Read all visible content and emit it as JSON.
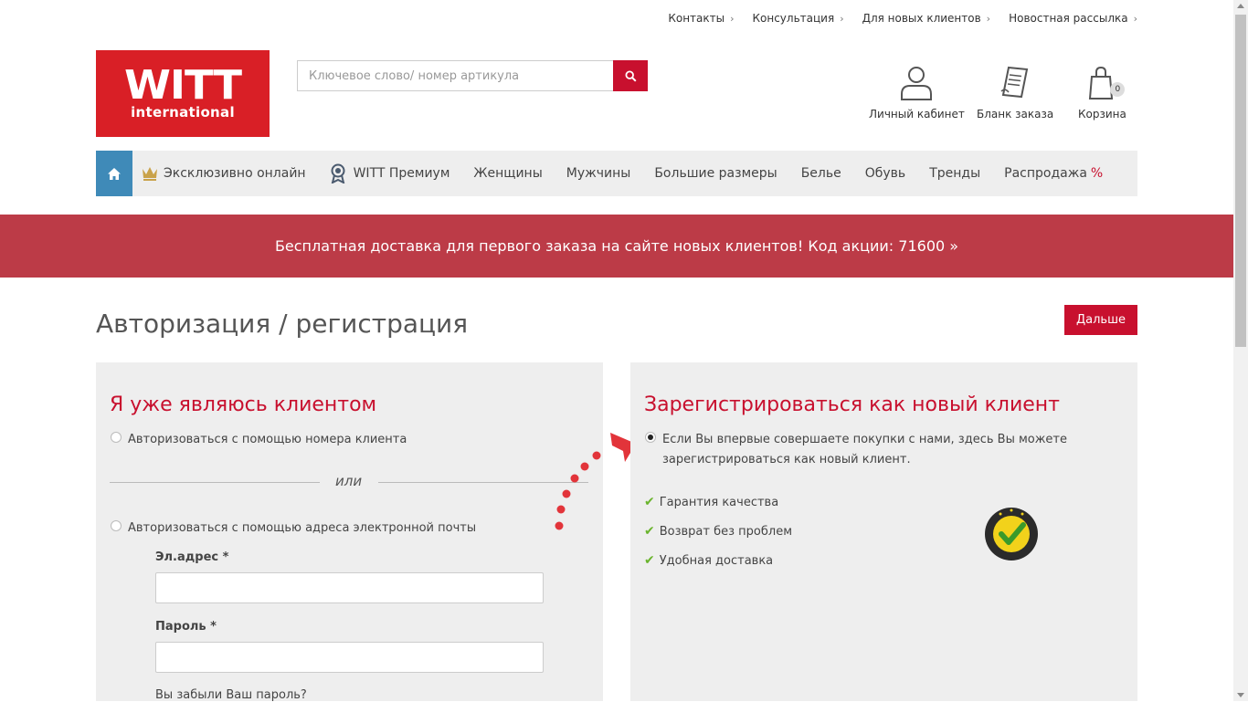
{
  "toplinks": [
    {
      "label": "Контакты"
    },
    {
      "label": "Консультация"
    },
    {
      "label": "Для новых клиентов"
    },
    {
      "label": "Новостная рассылка"
    }
  ],
  "logo": {
    "line1": "WITT",
    "line2": "international"
  },
  "search": {
    "placeholder": "Ключевое слово/ номер артикула"
  },
  "header_icons": {
    "account": "Личный кабинет",
    "order_form": "Бланк заказа",
    "cart": "Корзина",
    "cart_count": "0"
  },
  "nav": {
    "items": [
      {
        "label": "Эксклюзивно онлайн",
        "icon": "crown-icon"
      },
      {
        "label": "WITT Премиум",
        "icon": "award-icon"
      },
      {
        "label": "Женщины"
      },
      {
        "label": "Мужчины"
      },
      {
        "label": "Большие размеры"
      },
      {
        "label": "Белье"
      },
      {
        "label": "Обувь"
      },
      {
        "label": "Тренды"
      },
      {
        "label": "Распродажа",
        "suffix": "%"
      }
    ]
  },
  "promo": {
    "text": "Бесплатная доставка для первого заказа на сайте новых клиентов! Код акции: 71600 »"
  },
  "page": {
    "title": "Авторизация / регистрация",
    "next_button": "Дальше"
  },
  "existing": {
    "heading": "Я уже являюсь клиентом",
    "option_customer_number": "Авторизоваться с помощью номера клиента",
    "or": "или",
    "option_email": "Авторизоваться с помощью адреса электронной почты",
    "email_label": "Эл.адрес *",
    "password_label": "Пароль *",
    "forgot": "Вы забыли Ваш пароль?"
  },
  "register": {
    "heading": "Зарегистрироваться как новый клиент",
    "line1": "Если Вы впервые совершаете покупки с нами, здесь Вы можете",
    "line2": "зарегистрироваться как новый клиент.",
    "benefits": [
      "Гарантия качества",
      "Возврат без проблем",
      "Удобная доставка"
    ]
  },
  "colors": {
    "brand_red": "#c8102e",
    "logo_red": "#d91f26",
    "promo": "#bc3b47",
    "home_blue": "#3f8ab8",
    "check_green": "#6ab42d"
  }
}
